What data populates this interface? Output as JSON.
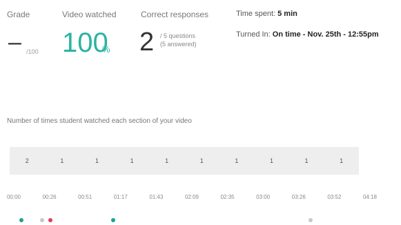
{
  "stats": {
    "grade": {
      "label": "Grade",
      "value": "–",
      "unit": "/100"
    },
    "video": {
      "label": "Video watched",
      "value": "100",
      "unit": "%"
    },
    "responses": {
      "label": "Correct responses",
      "value": "2",
      "detail_line1": "/ 5 questions",
      "detail_line2": "(5 answered)"
    }
  },
  "meta": {
    "time_label": "Time spent:",
    "time_value": "5 min",
    "turned_label": "Turned In:",
    "turned_value": "On time - Nov. 25th - 12:55pm"
  },
  "section_title": "Number of times student watched each section of your video",
  "segments": [
    2,
    1,
    1,
    1,
    1,
    1,
    1,
    1,
    1,
    1
  ],
  "timestamps": [
    "00:00",
    "00:26",
    "00:51",
    "01:17",
    "01:43",
    "02:09",
    "02:35",
    "03:00",
    "03:26",
    "03:52",
    "04:18"
  ],
  "colors": {
    "accent": "#2bb3a3",
    "marker_red": "#e23b5a",
    "marker_teal": "#1fa090",
    "marker_gray": "#c8c8c8"
  }
}
